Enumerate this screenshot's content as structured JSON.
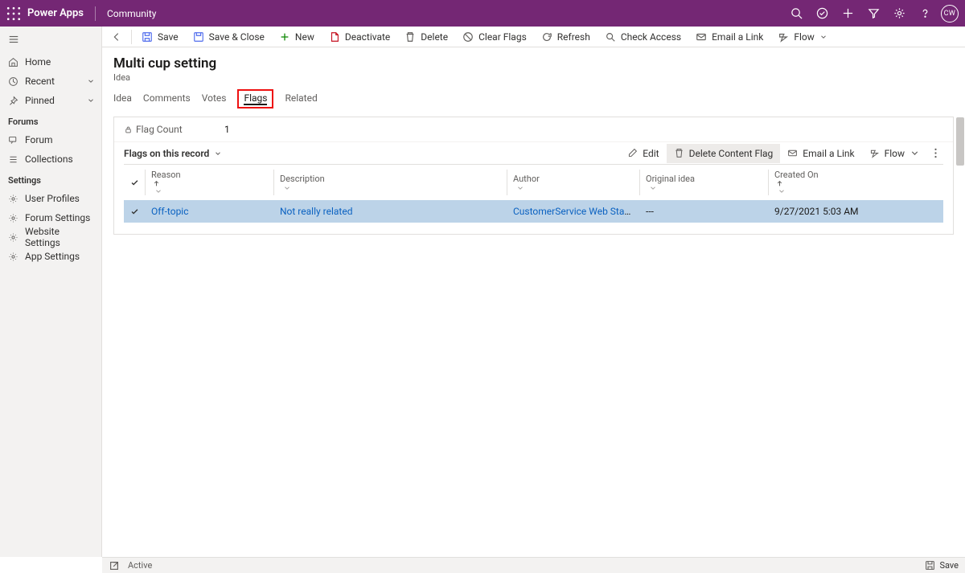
{
  "topbar": {
    "brand": "Power Apps",
    "env": "Community",
    "avatar": "CW"
  },
  "leftnav": {
    "top": [
      {
        "key": "home",
        "label": "Home"
      },
      {
        "key": "recent",
        "label": "Recent",
        "chev": true
      },
      {
        "key": "pinned",
        "label": "Pinned",
        "chev": true
      }
    ],
    "groups": [
      {
        "title": "Forums",
        "items": [
          {
            "key": "forum",
            "label": "Forum"
          },
          {
            "key": "collections",
            "label": "Collections"
          }
        ]
      },
      {
        "title": "Settings",
        "items": [
          {
            "key": "user-profiles",
            "label": "User Profiles"
          },
          {
            "key": "forum-settings",
            "label": "Forum Settings"
          },
          {
            "key": "website-settings",
            "label": "Website Settings"
          },
          {
            "key": "app-settings",
            "label": "App Settings"
          }
        ]
      }
    ]
  },
  "commands": {
    "save": "Save",
    "saveclose": "Save & Close",
    "new": "New",
    "deactivate": "Deactivate",
    "delete": "Delete",
    "clearflags": "Clear Flags",
    "refresh": "Refresh",
    "checkaccess": "Check Access",
    "emaillink": "Email a Link",
    "flow": "Flow"
  },
  "page": {
    "title": "Multi cup setting",
    "subtitle": "Idea"
  },
  "tabs": [
    {
      "key": "idea",
      "label": "Idea"
    },
    {
      "key": "comments",
      "label": "Comments"
    },
    {
      "key": "votes",
      "label": "Votes"
    },
    {
      "key": "flags",
      "label": "Flags",
      "active": true,
      "highlight": true
    },
    {
      "key": "related",
      "label": "Related"
    }
  ],
  "flagcount": {
    "label": "Flag Count",
    "value": "1"
  },
  "subgrid": {
    "title": "Flags on this record",
    "actions": {
      "edit": "Edit",
      "deletecontent": "Delete Content Flag",
      "emaillink": "Email a Link",
      "flow": "Flow"
    },
    "columns": {
      "reason": "Reason",
      "description": "Description",
      "author": "Author",
      "original": "Original idea",
      "created": "Created On"
    },
    "rows": [
      {
        "reason": "Off-topic",
        "description": "Not really related",
        "author": "CustomerService Web Staging",
        "original": "---",
        "created": "9/27/2021 5:03 AM"
      }
    ]
  },
  "statusbar": {
    "state": "Active",
    "save": "Save"
  }
}
